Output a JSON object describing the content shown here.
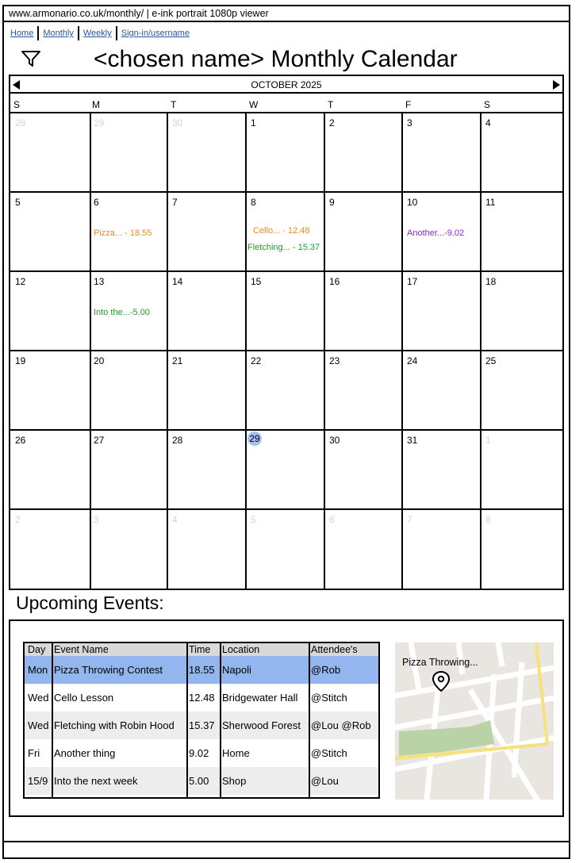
{
  "browser": {
    "url": "www.armonario.co.uk/monthly/ | e-ink portrait 1080p viewer"
  },
  "nav": [
    "Home",
    "Monthly",
    "Weekly",
    "Sign-in/username"
  ],
  "header": {
    "title": "<chosen name> Monthly Calendar",
    "filter_icon": "filter-icon"
  },
  "calendar": {
    "month_label": "OCTOBER 2025",
    "weekdays": [
      "S",
      "M",
      "T",
      "W",
      "T",
      "F",
      "S"
    ],
    "weeks": [
      [
        {
          "d": "28",
          "m": true
        },
        {
          "d": "29",
          "m": true
        },
        {
          "d": "30",
          "m": true
        },
        {
          "d": "1"
        },
        {
          "d": "2"
        },
        {
          "d": "3"
        },
        {
          "d": "4"
        }
      ],
      [
        {
          "d": "5"
        },
        {
          "d": "6"
        },
        {
          "d": "7"
        },
        {
          "d": "8"
        },
        {
          "d": "9"
        },
        {
          "d": "10"
        },
        {
          "d": "11"
        }
      ],
      [
        {
          "d": "12"
        },
        {
          "d": "13"
        },
        {
          "d": "14"
        },
        {
          "d": "15"
        },
        {
          "d": "16"
        },
        {
          "d": "17"
        },
        {
          "d": "18"
        }
      ],
      [
        {
          "d": "19"
        },
        {
          "d": "20"
        },
        {
          "d": "21"
        },
        {
          "d": "22"
        },
        {
          "d": "23"
        },
        {
          "d": "24"
        },
        {
          "d": "25"
        }
      ],
      [
        {
          "d": "26"
        },
        {
          "d": "27"
        },
        {
          "d": "28"
        },
        {
          "d": "29",
          "today": true
        },
        {
          "d": "30"
        },
        {
          "d": "31"
        },
        {
          "d": "1",
          "m": true
        }
      ],
      [
        {
          "d": "2",
          "m": true
        },
        {
          "d": "3",
          "m": true
        },
        {
          "d": "4",
          "m": true
        },
        {
          "d": "5",
          "m": true
        },
        {
          "d": "6",
          "m": true
        },
        {
          "d": "7",
          "m": true
        },
        {
          "d": "8",
          "m": true
        }
      ]
    ],
    "events": [
      {
        "week": 1,
        "day": 1,
        "text": "Pizza... - 18.55",
        "color": "orange"
      },
      {
        "week": 1,
        "day": 3,
        "text": "Cello... - 12.48",
        "color": "orange"
      },
      {
        "week": 1,
        "day": 3,
        "text": "Fletching... - 15.37",
        "color": "green"
      },
      {
        "week": 1,
        "day": 5,
        "text": "Another...-9.02",
        "color": "purple"
      },
      {
        "week": 2,
        "day": 1,
        "text": "Into the...-5.00",
        "color": "green"
      }
    ],
    "colors": {
      "orange": "#ee8a23",
      "green": "#249a2a",
      "purple": "#8a2ad6",
      "today": "#a7bff2"
    }
  },
  "upcoming": {
    "heading": "Upcoming Events:",
    "columns": [
      "Day",
      "Event Name",
      "Time",
      "Location",
      "Attendee's"
    ],
    "rows": [
      {
        "day": "Mon",
        "event": "Pizza Throwing Contest",
        "time": "18.55",
        "location": "Napoli",
        "attendees": "@Rob",
        "selected": true
      },
      {
        "day": "Wed",
        "event": "Cello Lesson",
        "time": "12.48",
        "location": "Bridgewater Hall",
        "attendees": "@Stitch"
      },
      {
        "day": "Wed",
        "event": "Fletching with Robin Hood",
        "time": "15.37",
        "location": "Sherwood Forest",
        "attendees": "@Lou @Rob"
      },
      {
        "day": "Fri",
        "event": "Another thing",
        "time": "9.02",
        "location": "Home",
        "attendees": "@Stitch"
      },
      {
        "day": "15/9",
        "event": "Into the next week",
        "time": "5.00",
        "location": "Shop",
        "attendees": "@Lou"
      }
    ],
    "colors": {
      "selected": "#94b6ef",
      "stripe": "#ededed",
      "header": "#d9d9d9"
    }
  },
  "map": {
    "label": "Pizza Throwing...",
    "pin_icon": "map-pin-icon"
  }
}
